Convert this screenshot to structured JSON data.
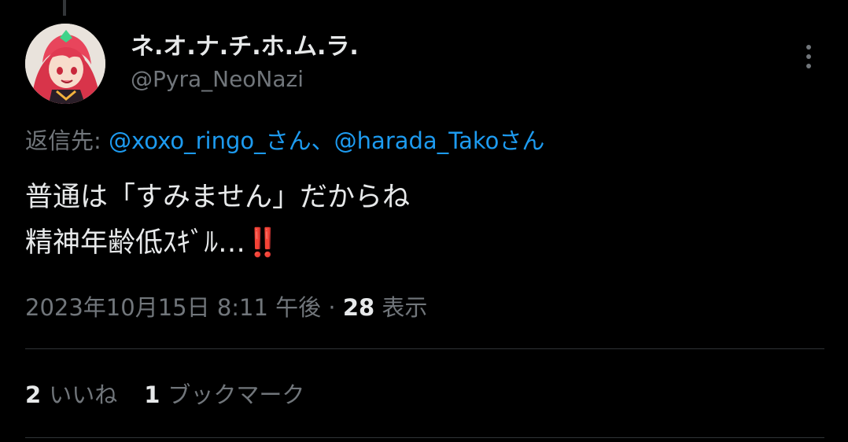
{
  "author": {
    "display_name": "ネ.オ.ナ.チ.ホ.ム.ラ.",
    "handle": "@Pyra_NeoNazi"
  },
  "more_icon": "more-vertical-icon",
  "reply": {
    "prefix": "返信先: ",
    "mention_1": "@xoxo_ringo_さん",
    "separator": "、",
    "mention_2": "@harada_Takoさん"
  },
  "tweet": {
    "line_1": "普通は「すみません」だからね",
    "line_2": "精神年齢低ｽｷﾞﾙ…",
    "emoji": "‼️"
  },
  "meta": {
    "timestamp": "2023年10月15日 8:11 午後",
    "dot": " · ",
    "views_count": "28",
    "views_label": " 表示"
  },
  "stats": {
    "likes_count": "2",
    "likes_label": "いいね",
    "bookmarks_count": "1",
    "bookmarks_label": "ブックマーク"
  },
  "colors": {
    "background": "#000000",
    "primary_text": "#e7e9ea",
    "secondary_text": "#71767b",
    "link": "#1d9bf0",
    "divider": "#2f3336"
  }
}
